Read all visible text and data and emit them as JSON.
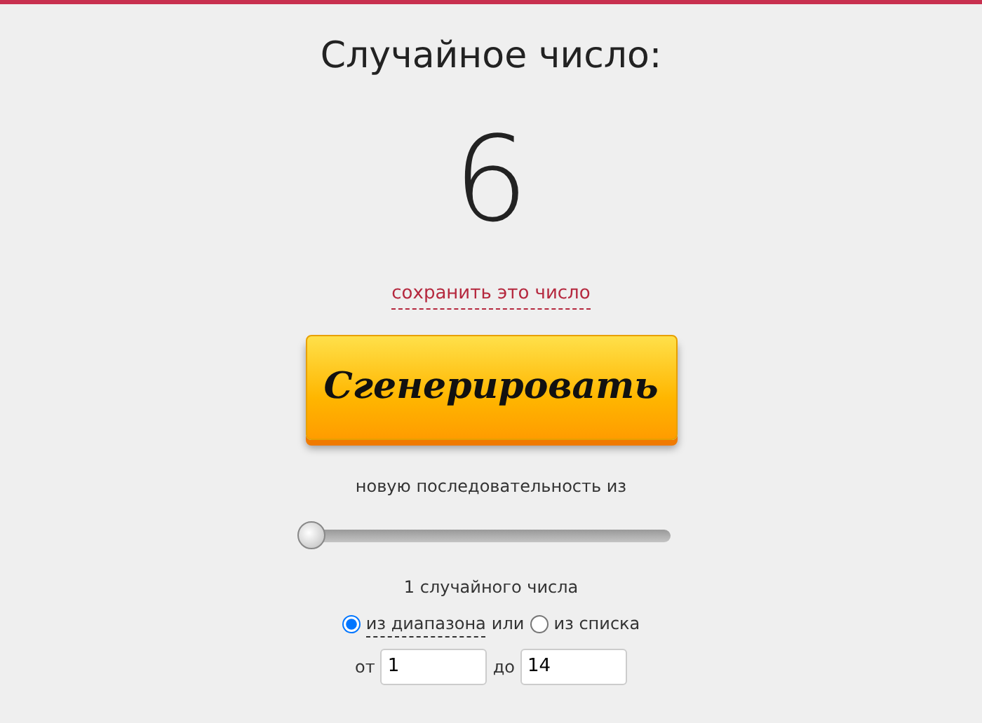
{
  "title": "Случайное число:",
  "result": "6",
  "save_link": "сохранить это число",
  "generate_button": "Сгенерировать",
  "sequence_label": "новую последовательность из",
  "count_slider": {
    "level": 0
  },
  "count_text": "1 случайного числа",
  "sources": [
    {
      "label": "из диапазона",
      "selected": true,
      "dotted": true
    },
    {
      "label": "из списка",
      "selected": false,
      "dotted": false
    }
  ],
  "sources_separator": "или",
  "range": {
    "from_label": "от",
    "from_value": "1",
    "to_label": "до",
    "to_value": "14"
  }
}
